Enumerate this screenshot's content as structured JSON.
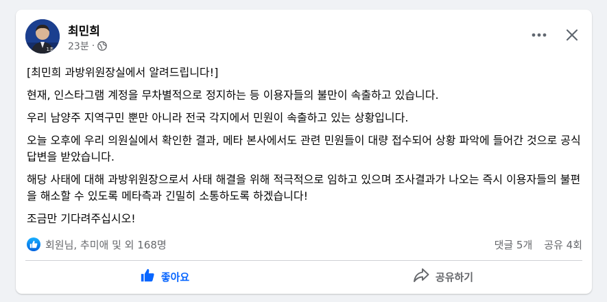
{
  "post": {
    "author": "최민희",
    "time": "23분",
    "separator": "·",
    "paragraphs": [
      "[최민희 과방위원장실에서 알려드립니다!]",
      "현재, 인스타그램 계정을 무차별적으로 정지하는 등 이용자들의 불만이 속출하고 있습니다.",
      "우리 남양주 지역구민 뿐만 아니라 전국 각지에서 민원이 속출하고 있는 상황입니다.",
      "오늘 오후에 우리 의원실에서 확인한 결과, 메타 본사에서도 관련 민원들이 대량 접수되어 상황 파악에 들어간 것으로 공식답변을 받았습니다.",
      "해당 사태에 대해 과방위원장으로서 사태 해결을 위해 적극적으로 임하고 있으며 조사결과가 나오는 즉시 이용자들의 불편을 해소할 수 있도록 메타측과 긴밀히 소통하도록 하겠습니다!",
      "조금만 기다려주십시오!"
    ],
    "avatar_caption": "1초"
  },
  "stats": {
    "reactions_text": "회원님, 추미애 및 외 168명",
    "comments": "댓글 5개",
    "shares": "공유 4회"
  },
  "actions": {
    "like_label": "좋아요",
    "share_label": "공유하기"
  },
  "icons": {
    "more": "more-horizontal-icon",
    "close": "close-icon",
    "globe": "globe-icon",
    "like": "thumbs-up-icon",
    "share": "share-arrow-icon"
  },
  "colors": {
    "brand_blue": "#0866ff",
    "secondary_text": "#65676b",
    "background": "#f0f2f5"
  }
}
